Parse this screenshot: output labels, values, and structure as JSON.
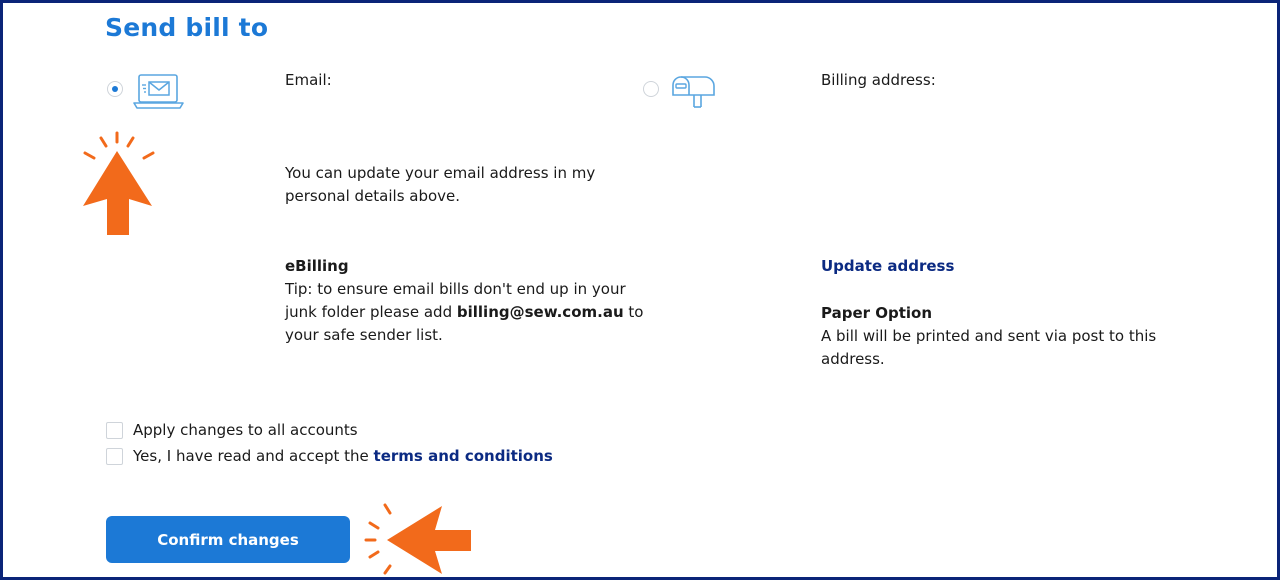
{
  "title": "Send bill to",
  "email_option": {
    "label": "Email:",
    "selected": true,
    "note": "You can update your email address in my personal details above.",
    "ebilling_heading": "eBilling",
    "tip_prefix": "Tip: to ensure email bills don't end up in your junk folder please add",
    "tip_email": "billing@sew.com.au",
    "tip_suffix": "to your safe sender list."
  },
  "post_option": {
    "label": "Billing address:",
    "selected": false,
    "update_link": "Update address",
    "paper_heading": "Paper Option",
    "paper_text": "A bill will be printed and sent via post to this address."
  },
  "checkboxes": {
    "apply_all": "Apply changes to all accounts",
    "terms_prefix": "Yes, I have read and accept the",
    "terms_link": "terms and conditions"
  },
  "confirm_button": "Confirm changes",
  "colors": {
    "accent": "#1c79d6",
    "link": "#0b2a82",
    "annotation": "#f26a1b",
    "frame": "#0b2478"
  },
  "icons": {
    "email": "laptop-envelope-icon",
    "post": "mailbox-icon",
    "annotation_1": "arrow-up-icon",
    "annotation_2": "arrow-left-icon"
  }
}
